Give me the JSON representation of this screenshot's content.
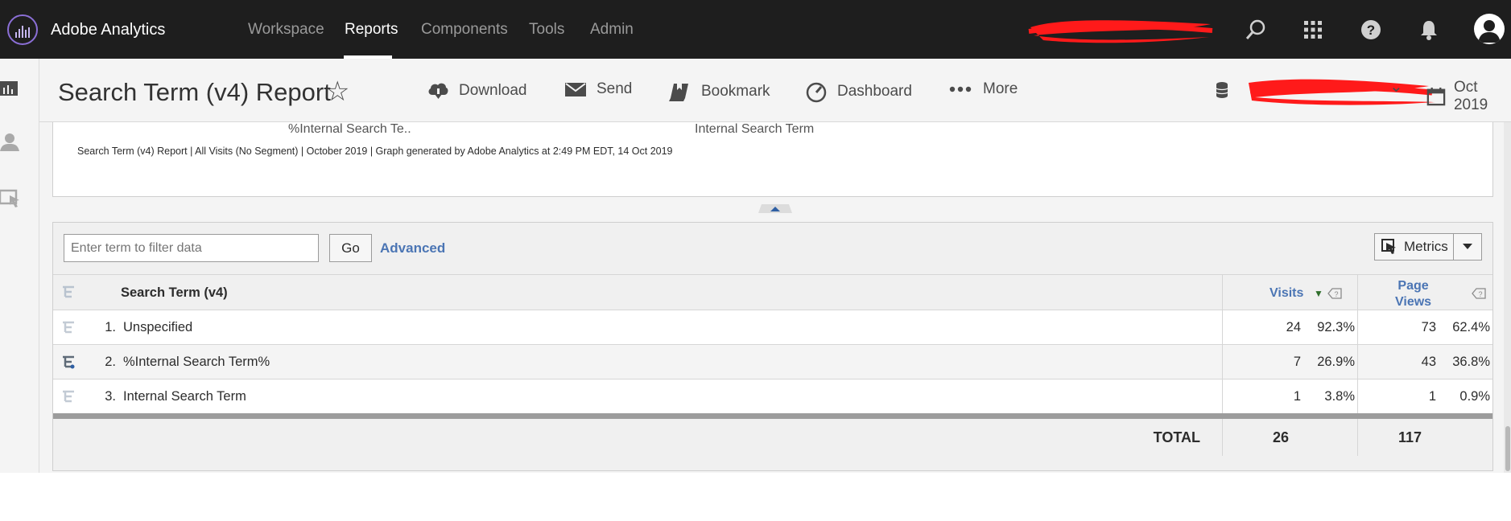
{
  "app": {
    "name": "Adobe Analytics"
  },
  "nav": {
    "items": [
      {
        "label": "Workspace",
        "active": false
      },
      {
        "label": "Reports",
        "active": true
      },
      {
        "label": "Components",
        "active": false
      },
      {
        "label": "Tools",
        "active": false
      },
      {
        "label": "Admin",
        "active": false
      }
    ]
  },
  "top_icons": [
    "search-icon",
    "apps-grid-icon",
    "help-icon",
    "notifications-bell-icon",
    "user-avatar-icon"
  ],
  "header": {
    "title": "Search Term (v4) Report",
    "actions": [
      "Download",
      "Send",
      "Bookmark",
      "Dashboard",
      "More"
    ],
    "date_label": "Oct 2019"
  },
  "graph": {
    "axis_labels": [
      "%Internal Search Te..",
      "Internal Search Term"
    ],
    "footer": "Search Term (v4) Report | All Visits (No Segment) | October 2019 | Graph generated by Adobe Analytics at  2:49 PM EDT, 14 Oct 2019"
  },
  "filter": {
    "placeholder": "Enter term to filter data",
    "go_label": "Go",
    "advanced_label": "Advanced",
    "metrics_label": "Metrics"
  },
  "table": {
    "dimension_header": "Search Term (v4)",
    "metric_headers": {
      "visits": "Visits",
      "page_views_line1": "Page",
      "page_views_line2": "Views"
    },
    "rows": [
      {
        "rank": "1.",
        "name": "Unspecified",
        "visits": "24",
        "visits_pct": "92.3%",
        "page_views": "73",
        "page_views_pct": "62.4%"
      },
      {
        "rank": "2.",
        "name": "%Internal Search Term%",
        "visits": "7",
        "visits_pct": "26.9%",
        "page_views": "43",
        "page_views_pct": "36.8%"
      },
      {
        "rank": "3.",
        "name": "Internal Search Term",
        "visits": "1",
        "visits_pct": "3.8%",
        "page_views": "1",
        "page_views_pct": "0.9%"
      }
    ],
    "total": {
      "label": "TOTAL",
      "visits": "26",
      "page_views": "117"
    }
  },
  "colors": {
    "topbar": "#1e1e1e",
    "link": "#4b75b4",
    "redaction": "#ff1a1a",
    "logo_ring": "#8b6fd6"
  }
}
